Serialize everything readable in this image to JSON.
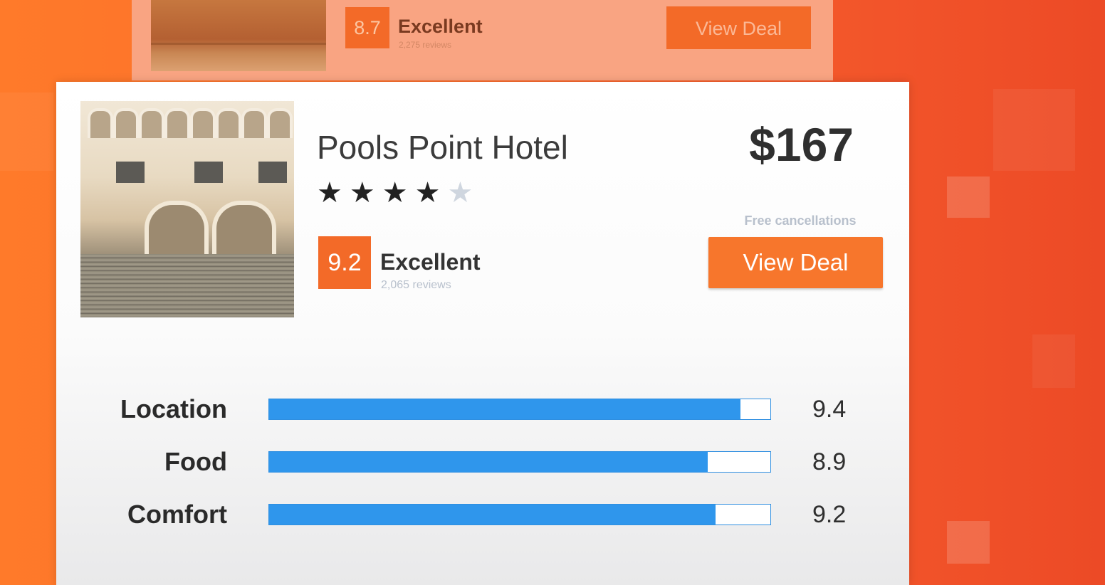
{
  "background_card": {
    "score": "8.7",
    "rating_label": "Excellent",
    "reviews": "2,275 reviews",
    "button_label": "View Deal"
  },
  "hotel": {
    "name": "Pools Point Hotel",
    "stars_filled": 4,
    "stars_total": 5,
    "stars_text": "★★★★",
    "stars_empty_text": "★",
    "score": "9.2",
    "rating_label": "Excellent",
    "reviews": "2,065 reviews",
    "price": "$167",
    "cancellation_note": "Free cancellations",
    "button_label": "View Deal"
  },
  "metrics": [
    {
      "label": "Location",
      "value": "9.4",
      "fill_fraction": 0.94
    },
    {
      "label": "Food",
      "value": "8.9",
      "fill_fraction": 0.875
    },
    {
      "label": "Comfort",
      "value": "9.2",
      "fill_fraction": 0.89
    }
  ],
  "colors": {
    "accent": "#f7762c",
    "score_badge": "#f36a28",
    "bar_fill": "#2f96ec"
  }
}
